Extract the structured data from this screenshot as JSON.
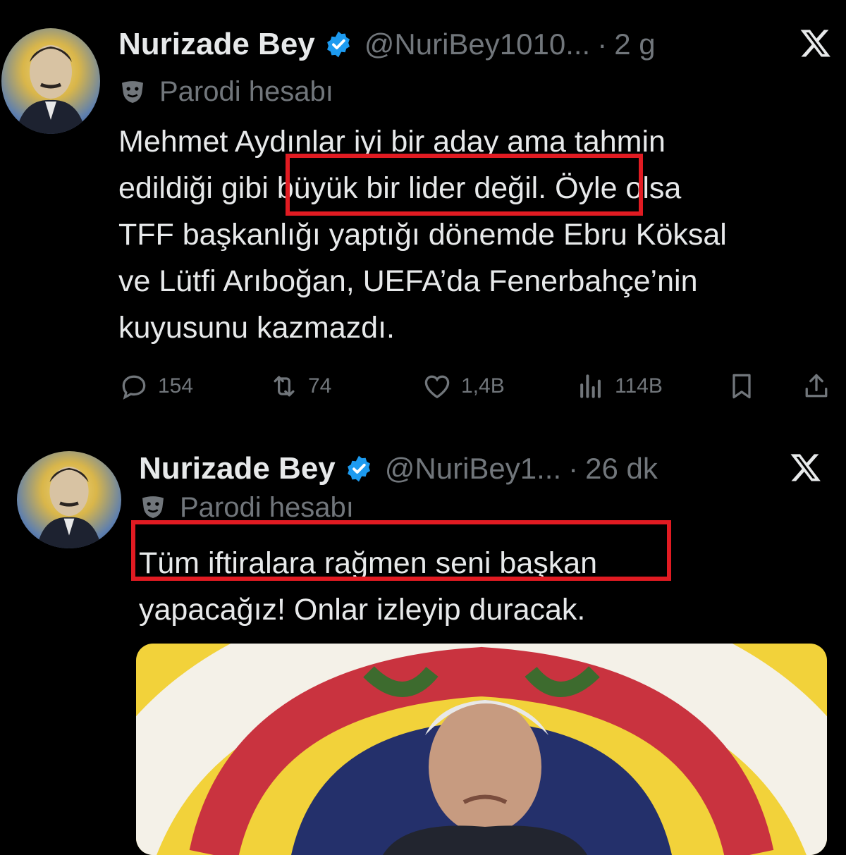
{
  "tweets": [
    {
      "display_name": "Nurizade Bey",
      "handle": "@NuriBey1010...",
      "separator": "·",
      "time": "2 g",
      "parody_label": "Parodi hesabı",
      "text_lines": [
        "Mehmet Aydınlar iyi bir aday ama tahmin",
        "edildiği gibi büyük bir lider değil. Öyle olsa",
        "TFF başkanlığı yaptığı dönemde Ebru Köksal",
        "ve Lütfi Arıboğan, UEFA’da Fenerbahçe’nin",
        "kuyusunu kazmazdı."
      ],
      "highlighted_phrase": "büyük bir lider değil.",
      "stats": {
        "replies": "154",
        "retweets": "74",
        "likes": "1,4B",
        "views": "114B"
      }
    },
    {
      "display_name": "Nurizade Bey",
      "handle": "@NuriBey1...",
      "separator": "·",
      "time": "26 dk",
      "parody_label": "Parodi hesabı",
      "text_lines": [
        "Tüm iftiralara rağmen seni başkan",
        "yapacağız! Onlar izleyip duracak."
      ],
      "highlighted_phrase": "Tüm iftiralara rağmen seni başkan"
    }
  ],
  "icons": {
    "verified": "verified-badge-icon",
    "x_logo": "x-logo-icon",
    "parody": "theater-mask-icon",
    "reply": "reply-icon",
    "retweet": "retweet-icon",
    "like": "heart-icon",
    "views": "views-icon",
    "bookmark": "bookmark-icon",
    "share": "share-icon"
  },
  "colors": {
    "background": "#000000",
    "text": "#e7e9ea",
    "muted": "#71767b",
    "verified": "#1d9bf0",
    "highlight_box": "#e11b22"
  }
}
